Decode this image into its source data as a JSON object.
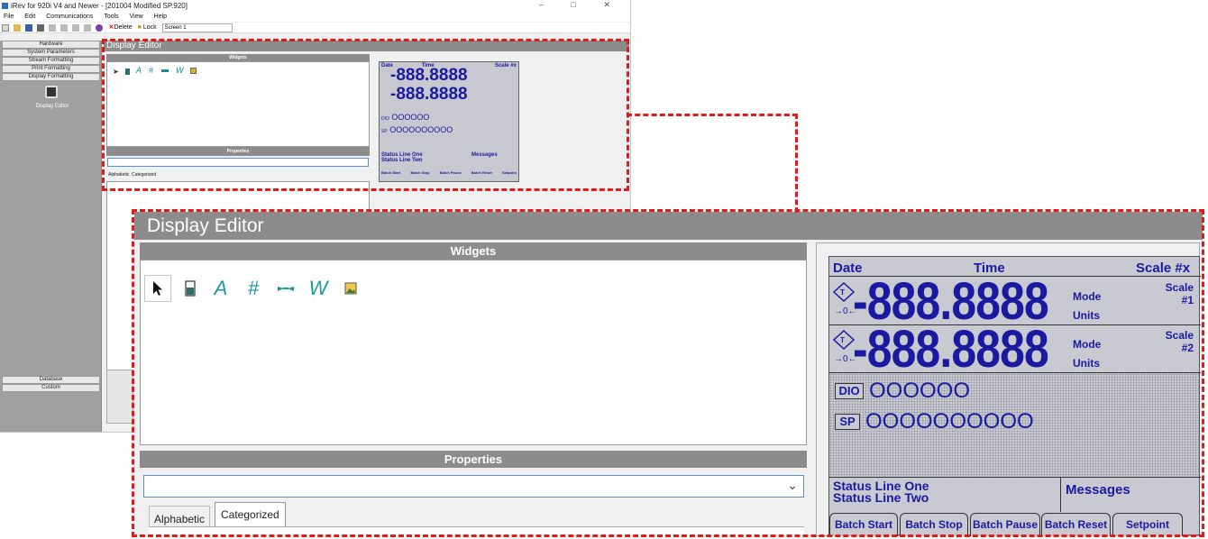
{
  "app": {
    "window_title": "iRev for 920i V4 and Newer - [201004 Modified SP.920]",
    "window_controls": "–  □  ✕",
    "menu": [
      "File",
      "Edit",
      "Communications",
      "Tools",
      "View",
      "Help"
    ],
    "toolbar": {
      "delete_label": "Delete",
      "lock_label": "Lock",
      "screen_combo": "Screen 1"
    },
    "nav": {
      "top_items": [
        "Hardware",
        "System Parameters",
        "Stream Formatting",
        "Print Formatting",
        "Display Formatting"
      ],
      "active_icon_label": "Display Editor",
      "bottom_items": [
        "Database",
        "Custom"
      ]
    }
  },
  "editor": {
    "title": "Display Editor",
    "widgets_header": "Widgets",
    "widget_tools": [
      "pointer-icon",
      "bargraph-icon",
      "text-icon",
      "numeric-icon",
      "symbol-icon",
      "weight-icon",
      "bitmap-icon"
    ],
    "properties_header": "Properties",
    "properties_tabs": [
      "Alphabetic",
      "Categorized"
    ],
    "properties_combo_value": ""
  },
  "lcd": {
    "header": {
      "date": "Date",
      "time": "Time",
      "scale": "Scale #x"
    },
    "weights": [
      {
        "value": "-888.8888",
        "mode": "Mode",
        "units": "Units",
        "scale_label": "Scale",
        "scale_num": "#1"
      },
      {
        "value": "-888.8888",
        "mode": "Mode",
        "units": "Units",
        "scale_label": "Scale",
        "scale_num": "#2"
      }
    ],
    "dio_label": "DIO",
    "dio_circles": "OOOOOO",
    "sp_label": "SP",
    "sp_circles": "OOOOOOOOOO",
    "status_line_one": "Status Line One",
    "status_line_two": "Status Line Two",
    "messages": "Messages",
    "softkeys": [
      "Batch Start",
      "Batch Stop",
      "Batch Pause",
      "Batch Reset",
      "Setpoint"
    ]
  },
  "colors": {
    "lcd_text": "#1a1aa0",
    "lcd_bg": "#c9c9d2",
    "callout": "#e01b1b",
    "header_gray": "#8c8c8c"
  }
}
